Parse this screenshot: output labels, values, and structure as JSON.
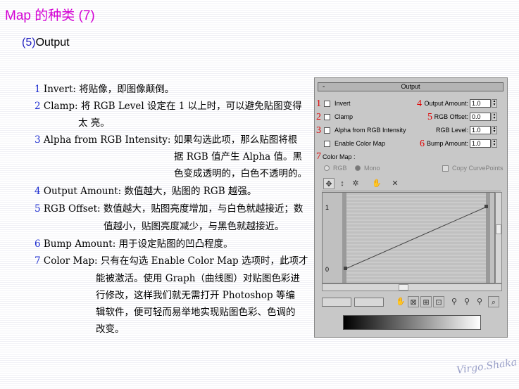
{
  "title": "Map 的种类 (7)",
  "subtitle": {
    "num": "(5)",
    "text": "Output"
  },
  "items": [
    {
      "n": "1",
      "lines": [
        "Invert: 将贴像，即图像颠倒。"
      ]
    },
    {
      "n": "2",
      "lines": [
        "Clamp: 将 RGB Level 设定在 1 以上时，可以避免贴图变得",
        "太 亮。"
      ]
    },
    {
      "n": "3",
      "lines": [
        "Alpha from RGB Intensity: 如果勾选此项，那么贴图将根",
        "据 RGB 值产生 Alpha 值。黑",
        "色变成透明的，白色不透明的。"
      ]
    },
    {
      "n": "4",
      "lines": [
        "Output Amount: 数值越大，贴图的 RGB 越强。"
      ]
    },
    {
      "n": "5",
      "lines": [
        "RGB Offset: 数值越大，贴图亮度增加，与白色就越接近；数",
        "值越小，贴图亮度减少，与黑色就越接近。"
      ]
    },
    {
      "n": "6",
      "lines": [
        "Bump Amount: 用于设定贴图的凹凸程度。"
      ]
    },
    {
      "n": "7",
      "lines": [
        "Color Map: 只有在勾选 Enable Color Map 选项时，此项才",
        "能被激活。使用 Graph（曲线图）对贴图色彩进",
        "行修改，这样我们就无需打开 Photoshop 等编",
        "辑软件，便可轻而易举地实现贴图色彩、色调的",
        "改变。"
      ]
    }
  ],
  "panel": {
    "rollout_minus": "-",
    "rollout_title": "Output",
    "markers": [
      "1",
      "2",
      "3",
      "4",
      "5",
      "6",
      "7"
    ],
    "checkboxes": {
      "invert": "Invert",
      "clamp": "Clamp",
      "alpha": "Alpha from RGB Intensity",
      "enable_color_map": "Enable Color Map"
    },
    "fields": {
      "output_amount": {
        "label": "Output Amount:",
        "value": "1.0"
      },
      "rgb_offset": {
        "label": "RGB Offset:",
        "value": "0.0"
      },
      "rgb_level": {
        "label": "RGB Level:",
        "value": "1.0"
      },
      "bump_amount": {
        "label": "Bump Amount:",
        "value": "1.0"
      }
    },
    "color_map_label": "Color Map :",
    "radio_rgb": "RGB",
    "radio_mono": "Mono",
    "copy_curve": "Copy CurvePoints",
    "graph_label_top": "1",
    "graph_label_bottom": "0"
  },
  "signature": "Virgo.Shaka"
}
